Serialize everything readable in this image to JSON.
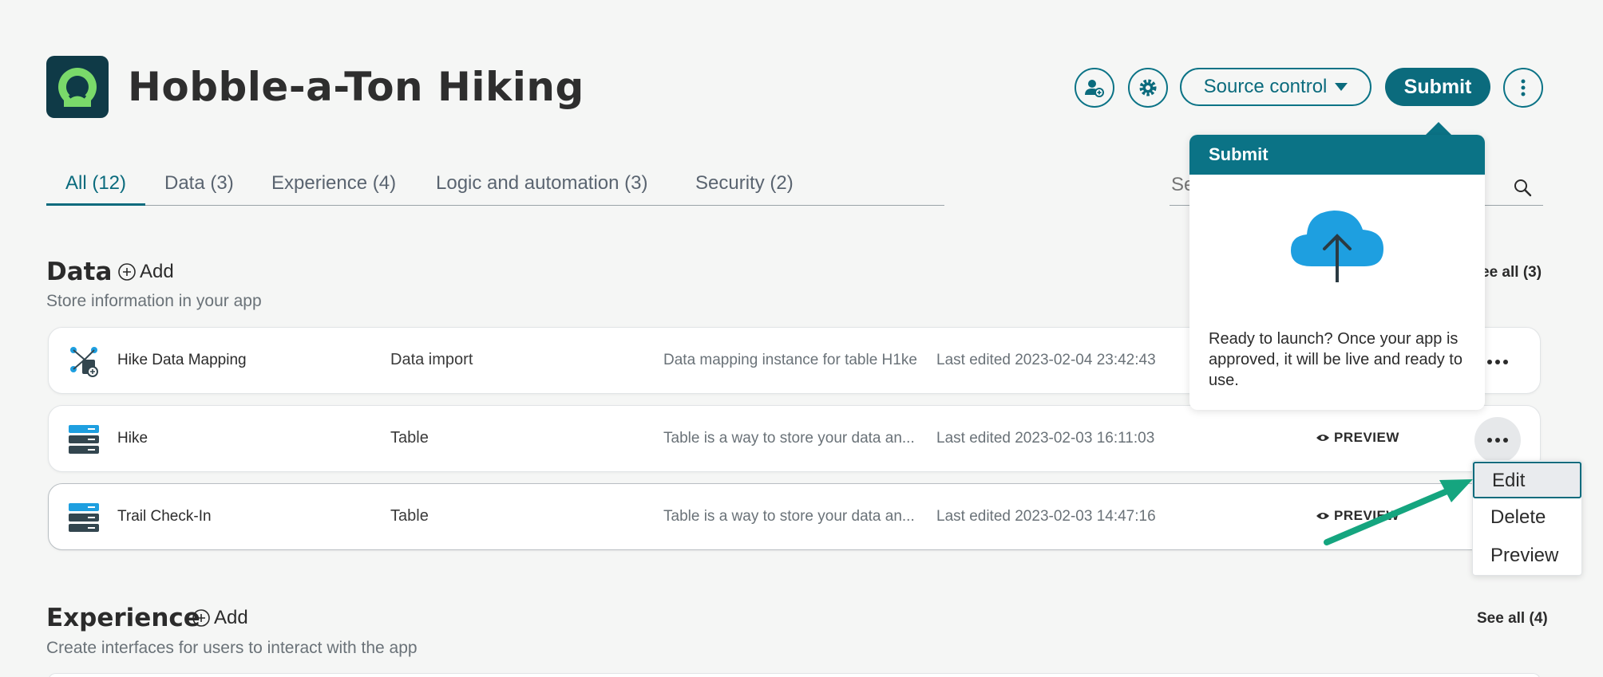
{
  "header": {
    "app_title": "Hobble-a-Ton Hiking",
    "logo_icon": "app-logo-icon",
    "source_control_label": "Source control",
    "submit_label": "Submit"
  },
  "tabs": [
    {
      "label": "All (12)",
      "active": true
    },
    {
      "label": "Data (3)"
    },
    {
      "label": "Experience (4)"
    },
    {
      "label": "Logic and automation (3)"
    },
    {
      "label": "Security (2)"
    }
  ],
  "search": {
    "placeholder": "Se"
  },
  "data_section": {
    "title": "Data",
    "add_label": "Add",
    "subtitle": "Store information in your app",
    "see_all_label": "ee all (3)",
    "rows": [
      {
        "name": "Hike Data Mapping",
        "type": "Data import",
        "description": "Data mapping instance for table H1ke",
        "last_edited": "Last edited 2023-02-04 23:42:43",
        "preview": ""
      },
      {
        "name": "Hike",
        "type": "Table",
        "description": "Table is a way to store your data an...",
        "last_edited": "Last edited 2023-02-03 16:11:03",
        "preview": "PREVIEW"
      },
      {
        "name": "Trail Check-In",
        "type": "Table",
        "description": "Table is a way to store your data an...",
        "last_edited": "Last edited 2023-02-03 14:47:16",
        "preview": "PREVIEW"
      }
    ]
  },
  "experience_section": {
    "title": "Experience",
    "add_label": "Add",
    "subtitle": "Create interfaces for users to interact with the app",
    "see_all_label": "See all (4)"
  },
  "submit_popover": {
    "title": "Submit",
    "body": "Ready to launch? Once your app is approved, it will be live and ready to use.",
    "icon": "cloud-upload-icon"
  },
  "context_menu": {
    "items": [
      "Edit",
      "Delete",
      "Preview"
    ]
  },
  "colors": {
    "accent": "#0b6b7d",
    "annotation_arrow": "#15a57f",
    "logo_bg": "#0f3a47",
    "logo_green": "#7ad96a",
    "cloud": "#1e9fe0"
  }
}
